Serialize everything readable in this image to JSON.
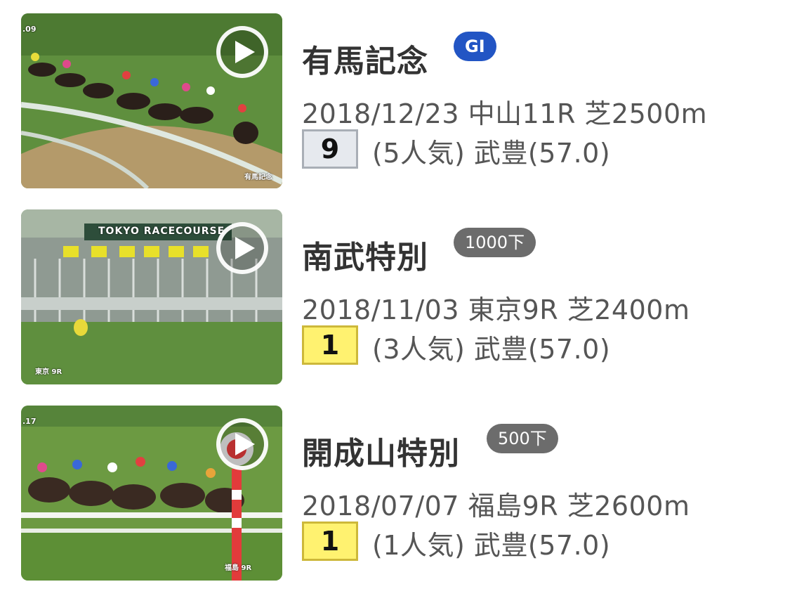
{
  "races": [
    {
      "name": "有馬記念",
      "badge": "GI",
      "badge_type": "grade",
      "badge_color": "#2255c4",
      "meta": "2018/12/23 中山11R 芝2500m",
      "rank": "9",
      "rank_style": "grey",
      "result": "(5人気) 武豊(57.0)",
      "thumb_overlay_left": ".09",
      "thumb_overlay_right": "有馬記念"
    },
    {
      "name": "南武特別",
      "badge": "1000下",
      "badge_type": "class",
      "badge_color": "#6c6c6c",
      "meta": "2018/11/03 東京9R 芝2400m",
      "rank": "1",
      "rank_style": "gold",
      "result": "(3人気) 武豊(57.0)",
      "thumb_banner": "TOKYO RACECOURSE",
      "thumb_overlay_left": "東京 9R"
    },
    {
      "name": "開成山特別",
      "badge": "500下",
      "badge_type": "class",
      "badge_color": "#6c6c6c",
      "meta": "2018/07/07 福島9R 芝2600m",
      "rank": "1",
      "rank_style": "gold",
      "result": "(1人気) 武豊(57.0)",
      "thumb_overlay_left": ".17",
      "thumb_overlay_right": "福島 9R"
    }
  ],
  "icons": {
    "play": "play-icon"
  }
}
